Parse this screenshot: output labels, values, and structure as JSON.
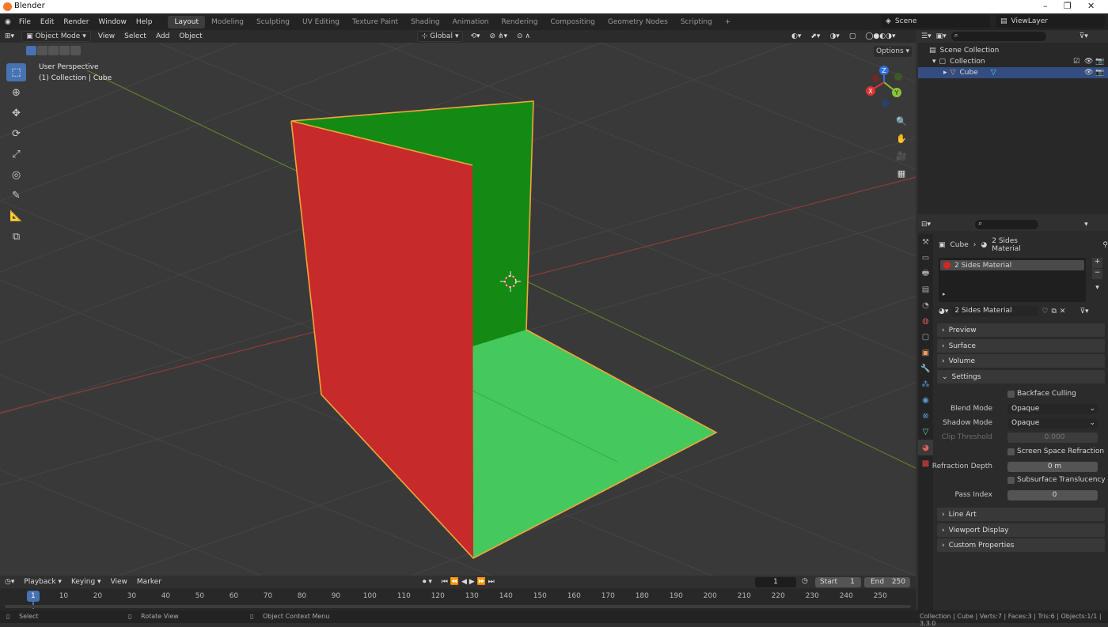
{
  "titlebar": {
    "title": "Blender",
    "minimize": "–",
    "maximize": "❐",
    "close": "✕"
  },
  "menu": [
    "File",
    "Edit",
    "Render",
    "Window",
    "Help"
  ],
  "workspaces": [
    "Layout",
    "Modeling",
    "Sculpting",
    "UV Editing",
    "Texture Paint",
    "Shading",
    "Animation",
    "Rendering",
    "Compositing",
    "Geometry Nodes",
    "Scripting"
  ],
  "add_workspace": "+",
  "scene": {
    "label": "Scene"
  },
  "viewlayer": {
    "label": "ViewLayer"
  },
  "viewport_header": {
    "mode": "Object Mode",
    "menus": [
      "View",
      "Select",
      "Add",
      "Object"
    ],
    "transform": "Global",
    "options": "Options"
  },
  "viewport": {
    "overlay_title": "User Perspective",
    "overlay_sub": "(1) Collection | Cube",
    "gizmo": {
      "z": "Z",
      "y": "Y",
      "x": "X"
    },
    "colors": {
      "red_face": "#c62a2a",
      "green_back": "#138a13",
      "green_floor": "#46c95c",
      "outline": "#f2a53a"
    }
  },
  "outliner": {
    "scene_collection": "Scene Collection",
    "collection": "Collection",
    "cube": "Cube"
  },
  "properties": {
    "breadcrumb_obj": "Cube",
    "breadcrumb_mat": "2 Sides Material",
    "slot_name": "2 Sides Material",
    "material_name": "2 Sides Material",
    "panels": {
      "preview": "Preview",
      "surface": "Surface",
      "volume": "Volume",
      "settings": "Settings",
      "line_art": "Line Art",
      "viewport_display": "Viewport Display",
      "custom_properties": "Custom Properties"
    },
    "settings": {
      "backface_culling": "Backface Culling",
      "blend_mode_label": "Blend Mode",
      "blend_mode": "Opaque",
      "shadow_mode_label": "Shadow Mode",
      "shadow_mode": "Opaque",
      "clip_threshold_label": "Clip Threshold",
      "clip_threshold": "0.000",
      "ssr": "Screen Space Refraction",
      "refraction_depth_label": "Refraction Depth",
      "refraction_depth": "0 m",
      "sss": "Subsurface Translucency",
      "pass_index_label": "Pass Index",
      "pass_index": "0"
    }
  },
  "timeline": {
    "menus": [
      "Playback",
      "Keying",
      "View",
      "Marker"
    ],
    "current_frame": "1",
    "start_label": "Start",
    "start": "1",
    "end_label": "End",
    "end": "250",
    "ruler": [
      "1",
      "10",
      "20",
      "30",
      "40",
      "50",
      "60",
      "70",
      "80",
      "90",
      "100",
      "110",
      "120",
      "130",
      "140",
      "150",
      "160",
      "170",
      "180",
      "190",
      "200",
      "210",
      "220",
      "230",
      "240",
      "250"
    ]
  },
  "statusbar": {
    "select": "Select",
    "rotate": "Rotate View",
    "context": "Object Context Menu",
    "stats": "Collection | Cube | Verts:7 | Faces:3 | Tris:6 | Objects:1/1 | 3.3.0"
  }
}
